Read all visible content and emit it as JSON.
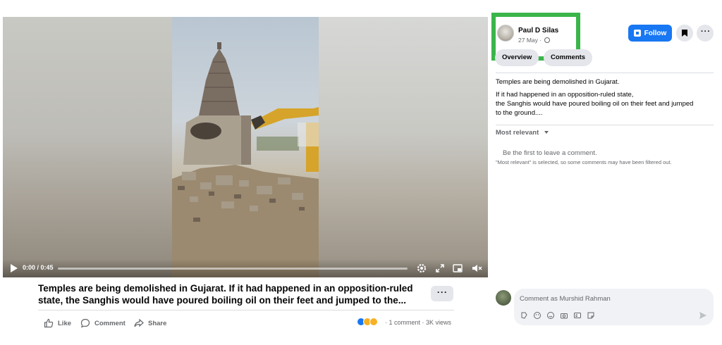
{
  "video": {
    "time": "0:00 / 0:45",
    "progress": 0.0
  },
  "post": {
    "title_line1": "Temples are being demolished in Gujarat. If it had happened in an opposition-ruled",
    "title_line2": "state, the Sanghis would have poured boiling oil on their feet and jumped to the...",
    "more_label": "···",
    "actions": {
      "like": "Like",
      "comment": "Comment",
      "share": "Share"
    },
    "stats": "· 1 comment · 3K views",
    "reactions": [
      "like",
      "sad",
      "haha"
    ]
  },
  "panel": {
    "author": "Paul D Silas",
    "date": "27 May ·",
    "follow_label": "Follow",
    "more_label": "···",
    "tabs": [
      "Overview",
      "Comments"
    ],
    "text_line1": "Temples are being demolished in Gujarat.",
    "text_line2": "If it had happened in an opposition-ruled state,",
    "text_line3": "the Sanghis would have poured boiling oil on their feet and jumped",
    "text_line4": "to the ground....",
    "sort_label": "Most relevant",
    "empty_text": "Be the first to leave a comment.",
    "filter_note": "\"Most relevant\" is selected, so some comments may have been filtered out.",
    "comment_placeholder": "Comment as Murshid Rahman"
  },
  "colors": {
    "accent": "#1877f2",
    "highlight": "#3bb54a",
    "secondary_text": "#65676b"
  }
}
